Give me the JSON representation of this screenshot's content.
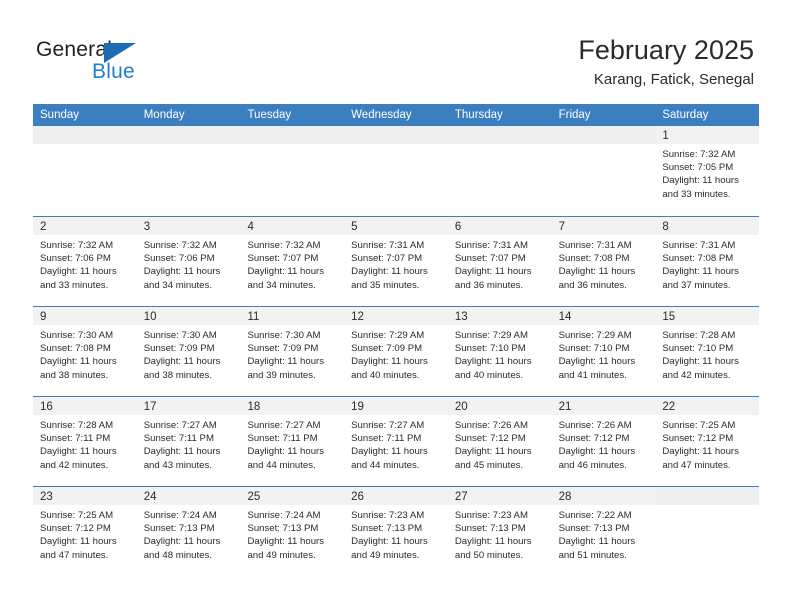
{
  "logo": {
    "primary_text": "General",
    "secondary_text": "Blue",
    "primary_color": "#231F20",
    "secondary_color": "#1B7FD4",
    "triangle_color": "#1B6CB5"
  },
  "header": {
    "title": "February 2025",
    "subtitle": "Karang, Fatick, Senegal"
  },
  "theme": {
    "header_row_bg": "#3C7FC0",
    "header_row_text": "#FFFFFF",
    "daynum_band_bg": "#F2F2F2",
    "row_divider": "#3C7FC0",
    "body_text": "#2B2B2B"
  },
  "weekdays": [
    "Sunday",
    "Monday",
    "Tuesday",
    "Wednesday",
    "Thursday",
    "Friday",
    "Saturday"
  ],
  "weeks": [
    [
      {
        "day": "",
        "lines": []
      },
      {
        "day": "",
        "lines": []
      },
      {
        "day": "",
        "lines": []
      },
      {
        "day": "",
        "lines": []
      },
      {
        "day": "",
        "lines": []
      },
      {
        "day": "",
        "lines": []
      },
      {
        "day": "1",
        "lines": [
          "Sunrise: 7:32 AM",
          "Sunset: 7:05 PM",
          "Daylight: 11 hours",
          "and 33 minutes."
        ]
      }
    ],
    [
      {
        "day": "2",
        "lines": [
          "Sunrise: 7:32 AM",
          "Sunset: 7:06 PM",
          "Daylight: 11 hours",
          "and 33 minutes."
        ]
      },
      {
        "day": "3",
        "lines": [
          "Sunrise: 7:32 AM",
          "Sunset: 7:06 PM",
          "Daylight: 11 hours",
          "and 34 minutes."
        ]
      },
      {
        "day": "4",
        "lines": [
          "Sunrise: 7:32 AM",
          "Sunset: 7:07 PM",
          "Daylight: 11 hours",
          "and 34 minutes."
        ]
      },
      {
        "day": "5",
        "lines": [
          "Sunrise: 7:31 AM",
          "Sunset: 7:07 PM",
          "Daylight: 11 hours",
          "and 35 minutes."
        ]
      },
      {
        "day": "6",
        "lines": [
          "Sunrise: 7:31 AM",
          "Sunset: 7:07 PM",
          "Daylight: 11 hours",
          "and 36 minutes."
        ]
      },
      {
        "day": "7",
        "lines": [
          "Sunrise: 7:31 AM",
          "Sunset: 7:08 PM",
          "Daylight: 11 hours",
          "and 36 minutes."
        ]
      },
      {
        "day": "8",
        "lines": [
          "Sunrise: 7:31 AM",
          "Sunset: 7:08 PM",
          "Daylight: 11 hours",
          "and 37 minutes."
        ]
      }
    ],
    [
      {
        "day": "9",
        "lines": [
          "Sunrise: 7:30 AM",
          "Sunset: 7:08 PM",
          "Daylight: 11 hours",
          "and 38 minutes."
        ]
      },
      {
        "day": "10",
        "lines": [
          "Sunrise: 7:30 AM",
          "Sunset: 7:09 PM",
          "Daylight: 11 hours",
          "and 38 minutes."
        ]
      },
      {
        "day": "11",
        "lines": [
          "Sunrise: 7:30 AM",
          "Sunset: 7:09 PM",
          "Daylight: 11 hours",
          "and 39 minutes."
        ]
      },
      {
        "day": "12",
        "lines": [
          "Sunrise: 7:29 AM",
          "Sunset: 7:09 PM",
          "Daylight: 11 hours",
          "and 40 minutes."
        ]
      },
      {
        "day": "13",
        "lines": [
          "Sunrise: 7:29 AM",
          "Sunset: 7:10 PM",
          "Daylight: 11 hours",
          "and 40 minutes."
        ]
      },
      {
        "day": "14",
        "lines": [
          "Sunrise: 7:29 AM",
          "Sunset: 7:10 PM",
          "Daylight: 11 hours",
          "and 41 minutes."
        ]
      },
      {
        "day": "15",
        "lines": [
          "Sunrise: 7:28 AM",
          "Sunset: 7:10 PM",
          "Daylight: 11 hours",
          "and 42 minutes."
        ]
      }
    ],
    [
      {
        "day": "16",
        "lines": [
          "Sunrise: 7:28 AM",
          "Sunset: 7:11 PM",
          "Daylight: 11 hours",
          "and 42 minutes."
        ]
      },
      {
        "day": "17",
        "lines": [
          "Sunrise: 7:27 AM",
          "Sunset: 7:11 PM",
          "Daylight: 11 hours",
          "and 43 minutes."
        ]
      },
      {
        "day": "18",
        "lines": [
          "Sunrise: 7:27 AM",
          "Sunset: 7:11 PM",
          "Daylight: 11 hours",
          "and 44 minutes."
        ]
      },
      {
        "day": "19",
        "lines": [
          "Sunrise: 7:27 AM",
          "Sunset: 7:11 PM",
          "Daylight: 11 hours",
          "and 44 minutes."
        ]
      },
      {
        "day": "20",
        "lines": [
          "Sunrise: 7:26 AM",
          "Sunset: 7:12 PM",
          "Daylight: 11 hours",
          "and 45 minutes."
        ]
      },
      {
        "day": "21",
        "lines": [
          "Sunrise: 7:26 AM",
          "Sunset: 7:12 PM",
          "Daylight: 11 hours",
          "and 46 minutes."
        ]
      },
      {
        "day": "22",
        "lines": [
          "Sunrise: 7:25 AM",
          "Sunset: 7:12 PM",
          "Daylight: 11 hours",
          "and 47 minutes."
        ]
      }
    ],
    [
      {
        "day": "23",
        "lines": [
          "Sunrise: 7:25 AM",
          "Sunset: 7:12 PM",
          "Daylight: 11 hours",
          "and 47 minutes."
        ]
      },
      {
        "day": "24",
        "lines": [
          "Sunrise: 7:24 AM",
          "Sunset: 7:13 PM",
          "Daylight: 11 hours",
          "and 48 minutes."
        ]
      },
      {
        "day": "25",
        "lines": [
          "Sunrise: 7:24 AM",
          "Sunset: 7:13 PM",
          "Daylight: 11 hours",
          "and 49 minutes."
        ]
      },
      {
        "day": "26",
        "lines": [
          "Sunrise: 7:23 AM",
          "Sunset: 7:13 PM",
          "Daylight: 11 hours",
          "and 49 minutes."
        ]
      },
      {
        "day": "27",
        "lines": [
          "Sunrise: 7:23 AM",
          "Sunset: 7:13 PM",
          "Daylight: 11 hours",
          "and 50 minutes."
        ]
      },
      {
        "day": "28",
        "lines": [
          "Sunrise: 7:22 AM",
          "Sunset: 7:13 PM",
          "Daylight: 11 hours",
          "and 51 minutes."
        ]
      },
      {
        "day": "",
        "lines": []
      }
    ]
  ]
}
